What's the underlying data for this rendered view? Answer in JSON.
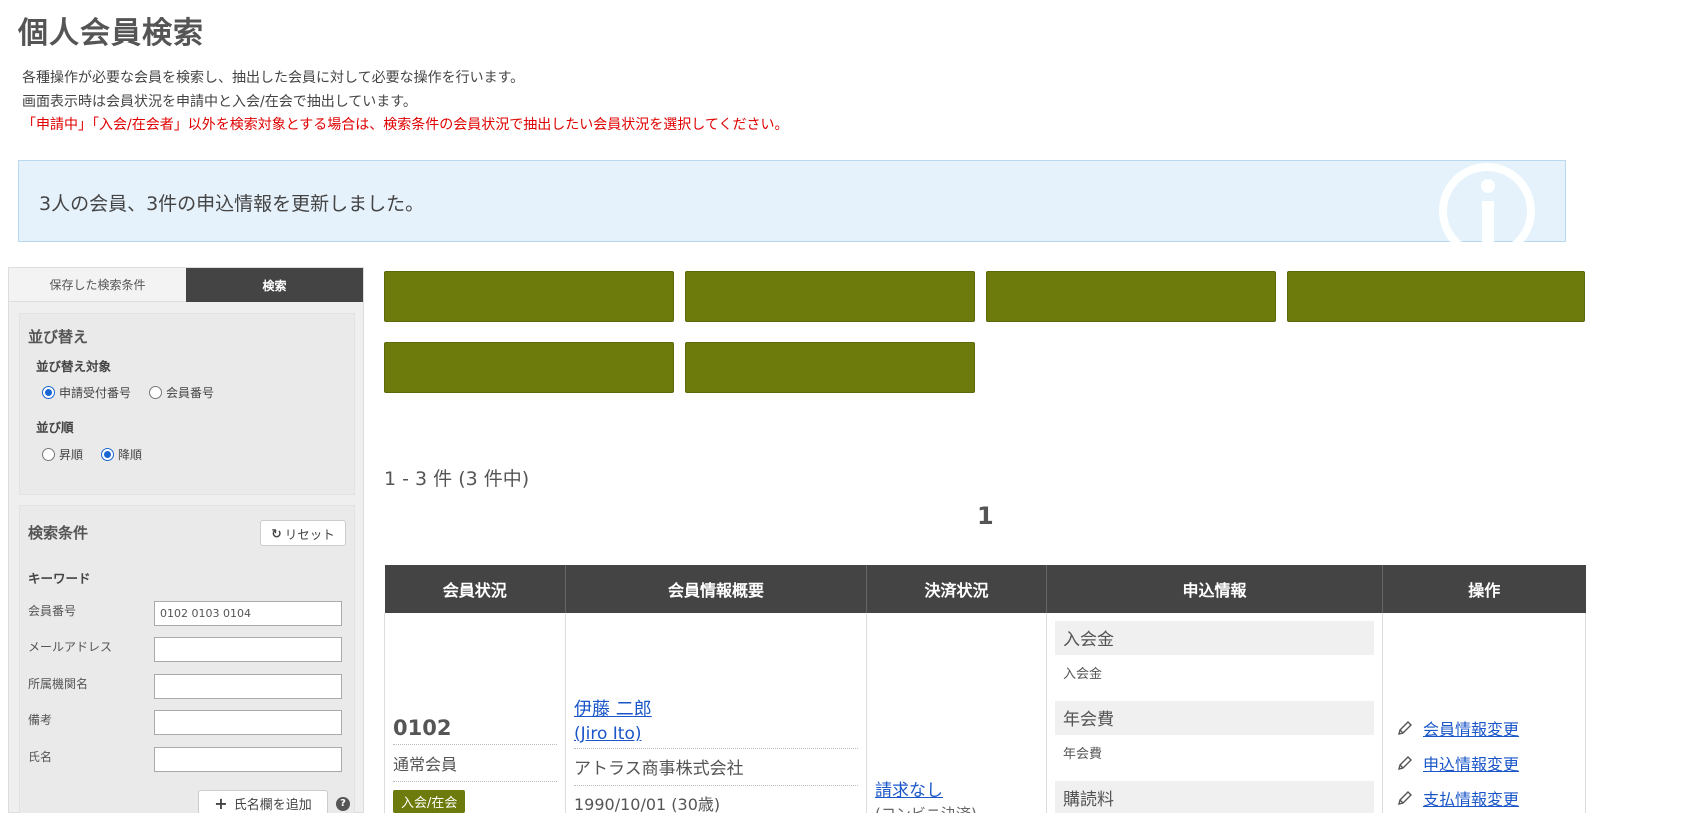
{
  "page": {
    "title": "個人会員検索",
    "desc_lines": [
      "各種操作が必要な会員を検索し、抽出した会員に対して必要な操作を行います。",
      "画面表示時は会員状況を申請中と入会/在会で抽出しています。"
    ],
    "warning": "「申請中」「入会/在会者」以外を検索対象とする場合は、検索条件の会員状況で抽出したい会員状況を選択してください。"
  },
  "notice": {
    "text": "3人の会員、3件の申込情報を更新しました。",
    "icon": "info-icon"
  },
  "sidebar": {
    "tabs": [
      {
        "label": "保存した検索条件",
        "active": false
      },
      {
        "label": "検索",
        "active": true
      }
    ],
    "sort": {
      "title": "並び替え",
      "target_label": "並び替え対象",
      "target_options": [
        {
          "label": "申請受付番号",
          "checked": true
        },
        {
          "label": "会員番号",
          "checked": false
        }
      ],
      "order_label": "並び順",
      "order_options": [
        {
          "label": "昇順",
          "checked": false
        },
        {
          "label": "降順",
          "checked": true
        }
      ]
    },
    "conditions": {
      "title": "検索条件",
      "reset_label": "リセット",
      "keyword_label": "キーワード",
      "fields": [
        {
          "label": "会員番号",
          "value": "0102 0103 0104"
        },
        {
          "label": "メールアドレス",
          "value": ""
        },
        {
          "label": "所属機関名",
          "value": ""
        },
        {
          "label": "備考",
          "value": ""
        },
        {
          "label": "氏名",
          "value": ""
        }
      ],
      "add_name_label": "氏名欄を追加",
      "help_icon": "?"
    }
  },
  "action_buttons": [
    "",
    "",
    "",
    "",
    "",
    ""
  ],
  "results": {
    "count_text": "1 - 3 件 (3 件中)",
    "page_number": "1",
    "columns": [
      "会員状況",
      "会員情報概要",
      "決済状況",
      "申込情報",
      "操作"
    ],
    "rows": [
      {
        "member_no": "0102",
        "member_type": "通常会員",
        "status": "入会/在会",
        "name": "伊藤 二郎",
        "name_en": "(Jiro Ito)",
        "company": "アトラス商事株式会社",
        "birth": "1990/10/01 (30歳)",
        "payment": "請求なし",
        "payment_sub": "(コンビニ決済)",
        "applications": [
          {
            "head": "入会金",
            "sub": "入会金"
          },
          {
            "head": "年会費",
            "sub": "年会費"
          },
          {
            "head": "購読料",
            "sub": ""
          }
        ],
        "operations": [
          "会員情報変更",
          "申込情報変更",
          "支払情報変更"
        ]
      }
    ]
  },
  "colors": {
    "accent": "#6d7a0c",
    "header_dark": "#444444",
    "link": "#1a56c8",
    "warning": "#e00000",
    "notice_bg": "#e6f2fb"
  }
}
